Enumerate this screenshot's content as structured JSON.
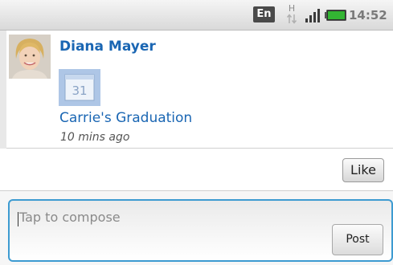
{
  "status_bar": {
    "input_method": "En",
    "network_type": "H",
    "time": "14:52",
    "icons": [
      "data-activity-icon",
      "signal-icon",
      "battery-icon"
    ]
  },
  "feed_item": {
    "author": "Diana Mayer",
    "calendar_day": "31",
    "event_title": "Carrie's Graduation",
    "time_ago": "10 mins ago"
  },
  "actions": {
    "like_label": "Like"
  },
  "compose": {
    "placeholder": "Tap to compose",
    "post_label": "Post"
  },
  "colors": {
    "link_blue": "#1a66b3",
    "focus_blue": "#3d9bd1",
    "battery_green": "#33b533"
  }
}
